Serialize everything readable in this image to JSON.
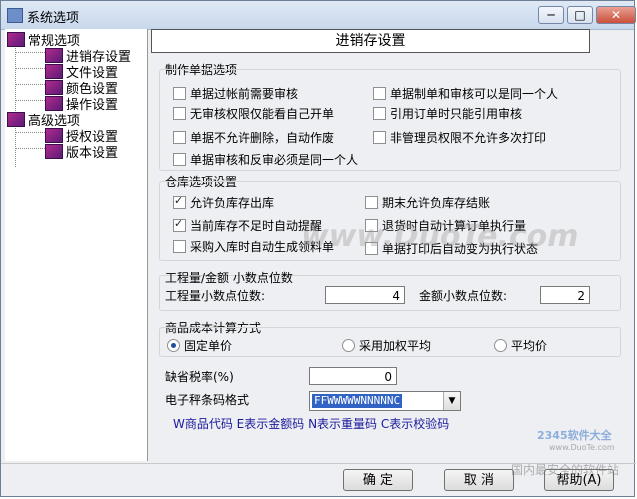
{
  "window": {
    "title": "系统选项",
    "buttons": {
      "minimize": "─",
      "maximize": "□",
      "close": "✕"
    }
  },
  "tree": {
    "items": [
      {
        "label": "常规选项",
        "level": 0
      },
      {
        "label": "进销存设置",
        "level": 1
      },
      {
        "label": "文件设置",
        "level": 1
      },
      {
        "label": "颜色设置",
        "level": 1
      },
      {
        "label": "操作设置",
        "level": 1
      },
      {
        "label": "高级选项",
        "level": 0
      },
      {
        "label": "授权设置",
        "level": 1
      },
      {
        "label": "版本设置",
        "level": 1
      }
    ]
  },
  "panel": {
    "header": "进销存设置"
  },
  "bills": {
    "title": "制作单据选项",
    "options": [
      {
        "label": "单据过帐前需要审核",
        "checked": false
      },
      {
        "label": "单据制单和审核可以是同一个人",
        "checked": false
      },
      {
        "label": "无审核权限仅能看自己开单",
        "checked": false
      },
      {
        "label": "引用订单时只能引用审核",
        "checked": false
      },
      {
        "label": "单据不允许删除，自动作废",
        "checked": false
      },
      {
        "label": "非管理员权限不允许多次打印",
        "checked": false
      },
      {
        "label": "单据审核和反审必须是同一个人",
        "checked": false
      }
    ]
  },
  "warehouse": {
    "title": "仓库选项设置",
    "options": [
      {
        "label": "允许负库存出库",
        "checked": true
      },
      {
        "label": "期末允许负库存结账",
        "checked": false
      },
      {
        "label": "当前库存不足时自动提醒",
        "checked": true
      },
      {
        "label": "退货时自动计算订单执行量",
        "checked": false
      },
      {
        "label": "采购入库时自动生成领料单",
        "checked": false
      },
      {
        "label": "单据打印后自动变为执行状态",
        "checked": false
      }
    ]
  },
  "decimals": {
    "title": "工程量/金额 小数点位数",
    "qty_label": "工程量小数点位数:",
    "qty_value": "4",
    "amount_label": "金额小数点位数:",
    "amount_value": "2"
  },
  "cost": {
    "title": "商品成本计算方式",
    "options": [
      {
        "label": "固定单价",
        "checked": true
      },
      {
        "label": "采用加权平均",
        "checked": false
      },
      {
        "label": "平均价",
        "checked": false
      }
    ]
  },
  "tax": {
    "label": "缺省税率(%)",
    "value": "0"
  },
  "barcode": {
    "label": "电子秤条码格式",
    "value": "FFWWWWWNNNNNC",
    "hint": "W商品代码 E表示金额码 N表示重量码 C表示校验码"
  },
  "footer": {
    "ok": "确  定",
    "cancel": "取  消",
    "help": "帮助(A)"
  },
  "watermark": {
    "main": "www.DuoTe.com",
    "corner": "2345软件大全",
    "corner_sub": "www.DuoTe.com",
    "corner_bottom": "国内最安全的软件站"
  }
}
